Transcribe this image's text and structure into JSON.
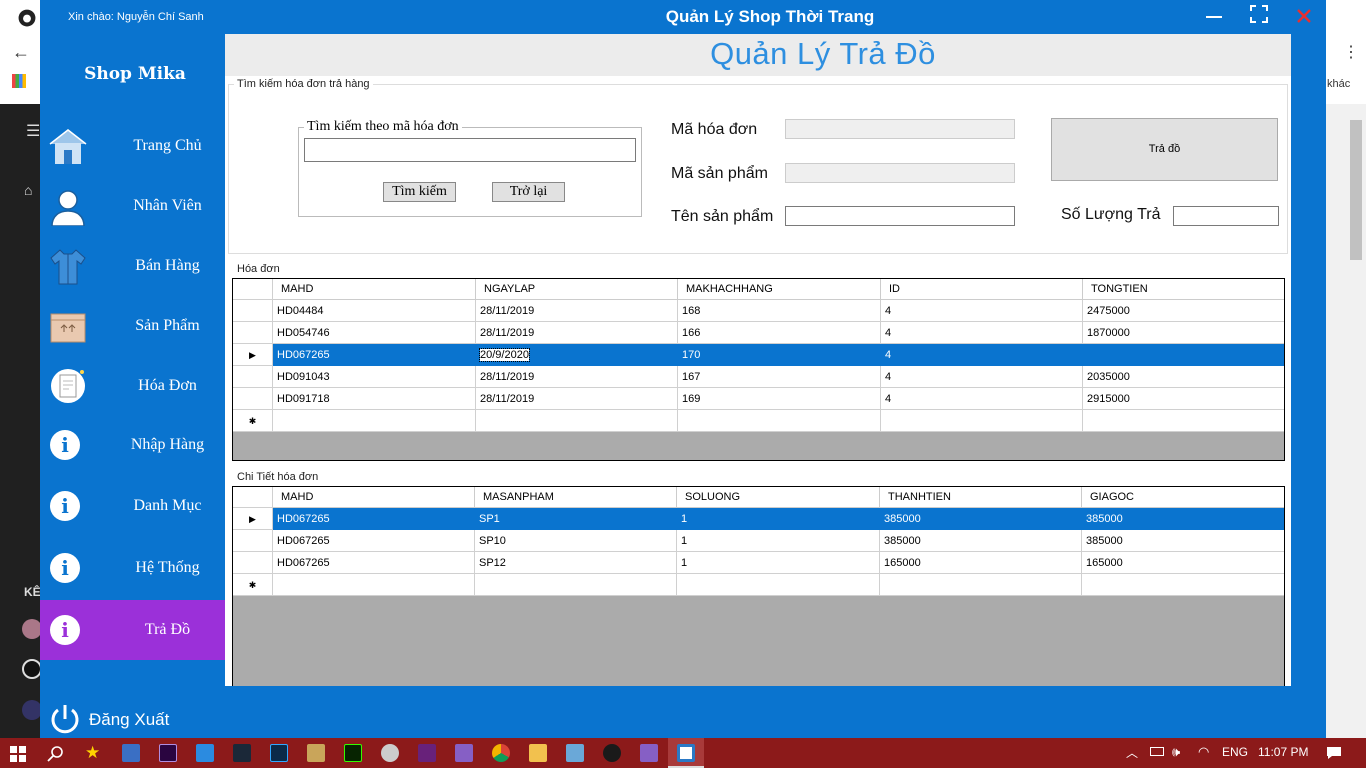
{
  "window": {
    "greeting": "Xin chào: Nguyễn Chí Sanh",
    "title": "Quản Lý Shop Thời Trang"
  },
  "sidebar": {
    "shop_name": "Shop Mika",
    "items": [
      {
        "label": "Trang Chủ",
        "icon": "home-icon"
      },
      {
        "label": "Nhân Viên",
        "icon": "user-icon"
      },
      {
        "label": "Bán Hàng",
        "icon": "shirt-icon"
      },
      {
        "label": "Sản Phẩm",
        "icon": "box-icon"
      },
      {
        "label": "Hóa Đơn",
        "icon": "receipt-icon"
      },
      {
        "label": "Nhập Hàng",
        "icon": "info-icon"
      },
      {
        "label": "Danh Mục",
        "icon": "info-icon"
      },
      {
        "label": "Hệ Thống",
        "icon": "info-icon"
      },
      {
        "label": "Trả Đồ",
        "icon": "info-icon",
        "active": true
      }
    ],
    "logout_label": "Đăng Xuất"
  },
  "page": {
    "title": "Quản Lý Trả Đồ"
  },
  "search": {
    "panel_label": "Tìm kiếm hóa đơn trả hàng",
    "box_label": "Tìm kiếm theo mã hóa đơn",
    "input_value": "",
    "search_button": "Tìm kiếm",
    "back_button": "Trở lại"
  },
  "form": {
    "invoice_code_label": "Mã hóa đơn",
    "product_code_label": "Mã sản phẩm",
    "product_name_label": "Tên sản phẩm",
    "return_qty_label": "Số Lượng Trả",
    "return_button": "Trả đồ"
  },
  "invoices": {
    "label": "Hóa đơn",
    "columns": [
      "MAHD",
      "NGAYLAP",
      "MAKHACHHANG",
      "ID",
      "TONGTIEN"
    ],
    "rows": [
      [
        "HD04484",
        "28/11/2019",
        "168",
        "4",
        "2475000"
      ],
      [
        "HD054746",
        "28/11/2019",
        "166",
        "4",
        "1870000"
      ],
      [
        "HD067265",
        "20/9/2020",
        "170",
        "4",
        ""
      ],
      [
        "HD091043",
        "28/11/2019",
        "167",
        "4",
        "2035000"
      ],
      [
        "HD091718",
        "28/11/2019",
        "169",
        "4",
        "2915000"
      ]
    ],
    "selected_row": 2
  },
  "details": {
    "label": "Chi Tiết hóa đơn",
    "columns": [
      "MAHD",
      "MASANPHAM",
      "SOLUONG",
      "THANHTIEN",
      "GIAGOC"
    ],
    "rows": [
      [
        "HD067265",
        "SP1",
        "1",
        "385000",
        "385000"
      ],
      [
        "HD067265",
        "SP10",
        "1",
        "385000",
        "385000"
      ],
      [
        "HD067265",
        "SP12",
        "1",
        "165000",
        "165000"
      ]
    ],
    "selected_row": 0
  },
  "taskbar": {
    "language": "ENG",
    "time": "11:07 PM"
  },
  "background": {
    "browser_text": "khác",
    "yt_label": "KÊ"
  },
  "colors": {
    "accent": "#0a74cf",
    "active_nav": "#9b30d9",
    "title_blue": "#2e8fe0",
    "taskbar": "#8c1a1a"
  }
}
